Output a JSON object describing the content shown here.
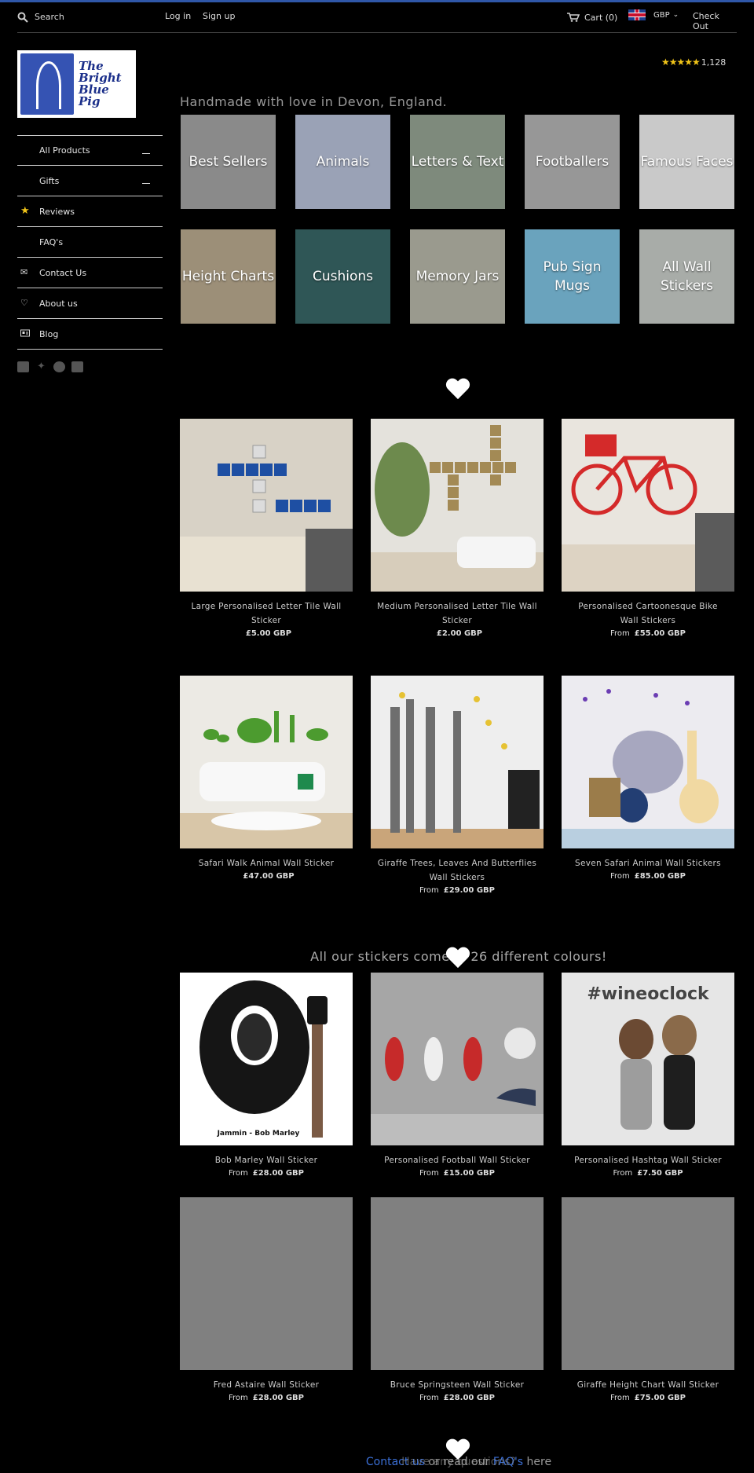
{
  "header": {
    "search_placeholder": "Search",
    "login": "Log in",
    "signup": "Sign up",
    "cart": "Cart (0)",
    "currency": "GBP",
    "checkout": "Check Out"
  },
  "logo": {
    "text_line1": "The",
    "text_line2": "Bright",
    "text_line3": "Blue",
    "text_line4": "Pig"
  },
  "sidebar": {
    "items": [
      {
        "label": "All Products",
        "icon": "none",
        "expandable": true
      },
      {
        "label": "Gifts",
        "icon": "none",
        "expandable": true
      },
      {
        "label": "Reviews",
        "icon": "star-icon",
        "expandable": false
      },
      {
        "label": "FAQ's",
        "icon": "none",
        "expandable": false
      },
      {
        "label": "Contact Us",
        "icon": "mail-icon",
        "expandable": false
      },
      {
        "label": "About us",
        "icon": "heart-icon",
        "expandable": false
      },
      {
        "label": "Blog",
        "icon": "blog-icon",
        "expandable": false
      }
    ],
    "social": [
      "facebook-icon",
      "twitter-icon",
      "pinterest-icon",
      "youtube-icon"
    ]
  },
  "rating": {
    "stars": "★★★★★",
    "count": "1,128"
  },
  "tagline": "Handmade with love in Devon, England.",
  "collections": [
    {
      "label": "Best Sellers",
      "bg": "#8a8a8a"
    },
    {
      "label": "Animals",
      "bg": "#9aa2b6"
    },
    {
      "label": "Letters & Text",
      "bg": "#7e8a7c"
    },
    {
      "label": "Footballers",
      "bg": "#979797"
    },
    {
      "label": "Famous Faces",
      "bg": "#c9c9c9"
    },
    {
      "label": "Height Charts",
      "bg": "#9c8f78"
    },
    {
      "label": "Cushions",
      "bg": "#2f5656"
    },
    {
      "label": "Memory Jars",
      "bg": "#9a9a8e"
    },
    {
      "label": "Pub Sign Mugs",
      "bg": "#6aa3bd"
    },
    {
      "label": "All Wall Stickers",
      "bg": "#a8aca8"
    }
  ],
  "section_colours": "All our stickers come in 26 different colours!",
  "products": [
    {
      "title": "Large Personalised Letter Tile Wall Sticker",
      "from": "",
      "price": "£5.00 GBP",
      "bg": "#d8d2c6"
    },
    {
      "title": "Medium Personalised Letter Tile Wall Sticker",
      "from": "",
      "price": "£2.00 GBP",
      "bg": "#e4e2dc"
    },
    {
      "title": "Personalised Cartoonesque Bike Wall Stickers",
      "from": "From",
      "price": "£55.00 GBP",
      "bg": "#e9e5de"
    },
    {
      "title": "Safari Walk Animal Wall Sticker",
      "from": "",
      "price": "£47.00 GBP",
      "bg": "#eceae4"
    },
    {
      "title": "Giraffe Trees, Leaves And Butterflies Wall Stickers",
      "from": "From",
      "price": "£29.00 GBP",
      "bg": "#eeeeee"
    },
    {
      "title": "Seven Safari Animal Wall Stickers",
      "from": "From",
      "price": "£85.00 GBP",
      "bg": "#ecebf0"
    },
    {
      "title": "Bob Marley Wall Sticker",
      "from": "From",
      "price": "£28.00 GBP",
      "bg": "#ffffff"
    },
    {
      "title": "Personalised Football Wall Sticker",
      "from": "From",
      "price": "£15.00 GBP",
      "bg": "#a6a6a6"
    },
    {
      "title": "Personalised Hashtag Wall Sticker",
      "from": "From",
      "price": "£7.50 GBP",
      "bg": "#e6e6e6"
    },
    {
      "title": "Fred Astaire Wall Sticker",
      "from": "From",
      "price": "£28.00 GBP",
      "bg": "#808080"
    },
    {
      "title": "Bruce Springsteen Wall Sticker",
      "from": "From",
      "price": "£28.00 GBP",
      "bg": "#808080"
    },
    {
      "title": "Giraffe Height Chart Wall Sticker",
      "from": "From",
      "price": "£75.00 GBP",
      "bg": "#808080"
    }
  ],
  "hashtag_text": "#wineoclock",
  "bob_caption": "Jammin - Bob Marley",
  "footer": {
    "contact_link": "Contact us",
    "middle": " or read our ",
    "faq_link": "FAQ's",
    "end": " here",
    "question": "Have any questions?"
  },
  "colors": {
    "accent": "#2f57a8",
    "star": "#f0c419",
    "link": "#3b6fd6"
  }
}
